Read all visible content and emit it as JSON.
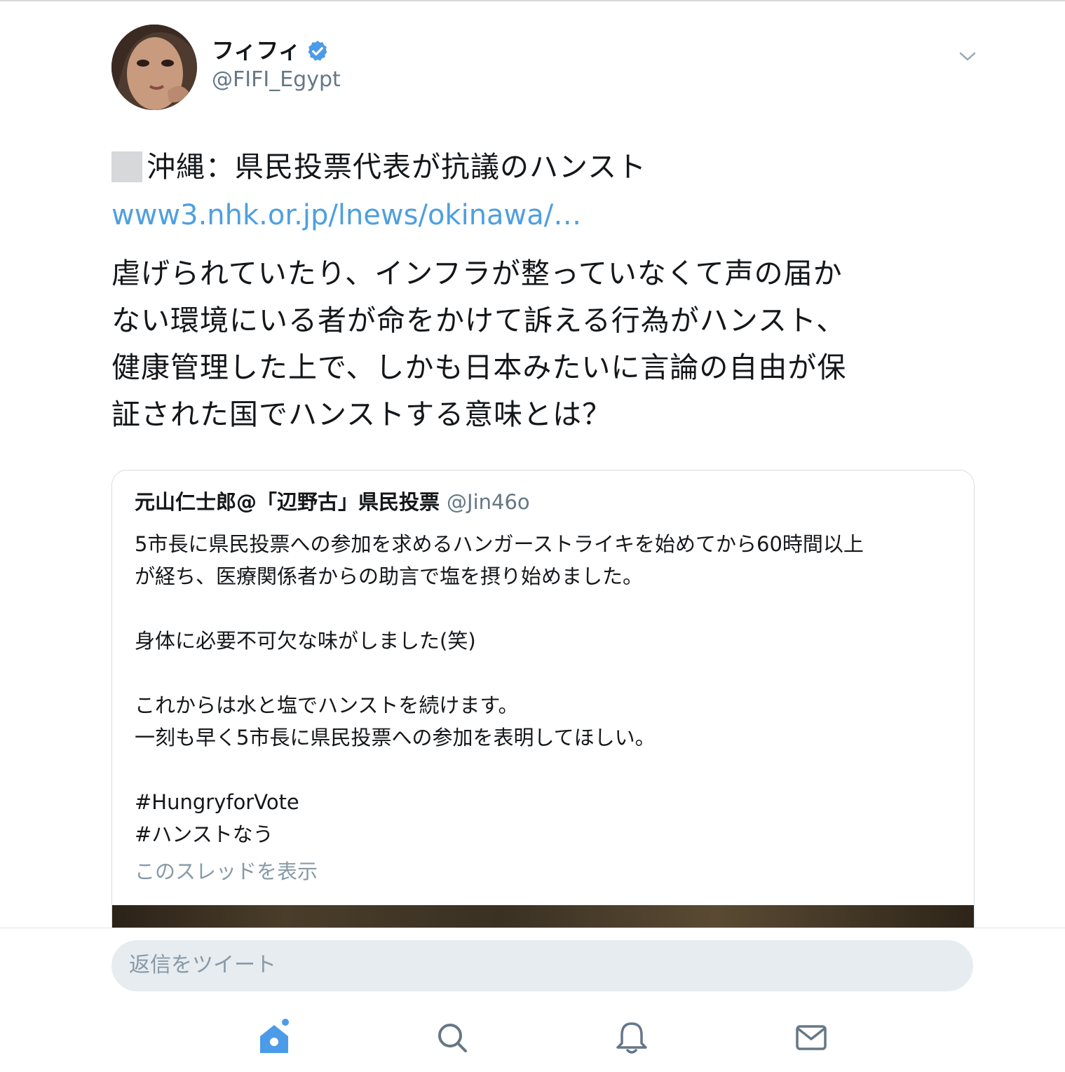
{
  "tweet": {
    "display_name": "フィフィ",
    "handle": "@FIFI_Egypt",
    "headline": "沖縄：県民投票代表が抗議のハンスト",
    "link": "www3.nhk.or.jp/lnews/okinawa/…",
    "body_lines": [
      "虐げられていたり、インフラが整っていなくて声の届か",
      "ない環境にいる者が命をかけて訴える行為がハンスト、",
      "健康管理した上で、しかも日本みたいに言論の自由が保",
      "証された国でハンストする意味とは？"
    ]
  },
  "quoted_tweet": {
    "display_name": "元山仁士郎@「辺野古」県民投票",
    "handle": "@Jin46o",
    "body_lines": [
      "5市長に県民投票への参加を求めるハンガーストライキを始めてから60時間以上",
      "が経ち、医療関係者からの助言で塩を摂り始めました。",
      "",
      "身体に必要不可欠な味がしました(笑)",
      "",
      "これからは水と塩でハンストを続けます。",
      "一刻も早く5市長に県民投票への参加を表明してほしい。",
      "",
      "#HungryforVote",
      "#ハンストなう"
    ],
    "show_thread": "このスレッドを表示"
  },
  "reply": {
    "placeholder": "返信をツイート"
  },
  "nav": {
    "items": [
      "home-icon",
      "search-icon",
      "notifications-icon",
      "messages-icon"
    ],
    "active_color": "#4c9be8",
    "inactive_color": "#657786"
  },
  "colors": {
    "link": "#4f9fe0",
    "verified": "#4c9be8",
    "secondary_text": "#657786"
  }
}
